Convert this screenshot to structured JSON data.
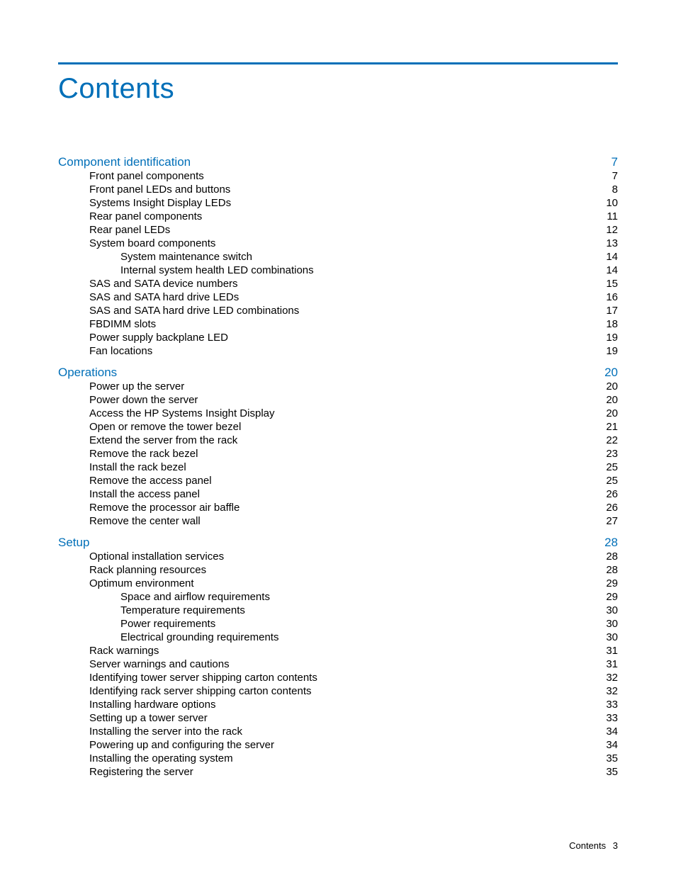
{
  "title": "Contents",
  "footer": {
    "label": "Contents",
    "page": "3"
  },
  "sections": [
    {
      "heading": {
        "label": "Component identification",
        "page": "7"
      },
      "entries": [
        {
          "level": 1,
          "label": "Front panel components",
          "page": "7"
        },
        {
          "level": 1,
          "label": "Front panel LEDs and buttons",
          "page": "8"
        },
        {
          "level": 1,
          "label": "Systems Insight Display LEDs",
          "page": "10"
        },
        {
          "level": 1,
          "label": "Rear panel components",
          "page": "11"
        },
        {
          "level": 1,
          "label": "Rear panel LEDs",
          "page": "12"
        },
        {
          "level": 1,
          "label": "System board components",
          "page": "13"
        },
        {
          "level": 2,
          "label": "System maintenance switch",
          "page": "14"
        },
        {
          "level": 2,
          "label": "Internal system health LED combinations",
          "page": "14"
        },
        {
          "level": 1,
          "label": "SAS and SATA device numbers",
          "page": "15"
        },
        {
          "level": 1,
          "label": "SAS and SATA hard drive LEDs",
          "page": "16"
        },
        {
          "level": 1,
          "label": "SAS and SATA hard drive LED combinations",
          "page": "17"
        },
        {
          "level": 1,
          "label": "FBDIMM slots",
          "page": "18"
        },
        {
          "level": 1,
          "label": "Power supply backplane LED",
          "page": "19"
        },
        {
          "level": 1,
          "label": "Fan locations",
          "page": "19"
        }
      ]
    },
    {
      "heading": {
        "label": "Operations",
        "page": "20"
      },
      "entries": [
        {
          "level": 1,
          "label": "Power up the server",
          "page": "20"
        },
        {
          "level": 1,
          "label": "Power down the server",
          "page": "20"
        },
        {
          "level": 1,
          "label": "Access the HP Systems Insight Display",
          "page": "20"
        },
        {
          "level": 1,
          "label": "Open or remove the tower bezel",
          "page": "21"
        },
        {
          "level": 1,
          "label": "Extend the server from the rack",
          "page": "22"
        },
        {
          "level": 1,
          "label": "Remove the rack bezel",
          "page": "23"
        },
        {
          "level": 1,
          "label": "Install the rack bezel",
          "page": "25"
        },
        {
          "level": 1,
          "label": "Remove the access panel",
          "page": "25"
        },
        {
          "level": 1,
          "label": "Install the access panel",
          "page": "26"
        },
        {
          "level": 1,
          "label": "Remove the processor air baffle",
          "page": "26"
        },
        {
          "level": 1,
          "label": "Remove the center wall",
          "page": "27"
        }
      ]
    },
    {
      "heading": {
        "label": "Setup",
        "page": "28"
      },
      "entries": [
        {
          "level": 1,
          "label": "Optional installation services",
          "page": "28"
        },
        {
          "level": 1,
          "label": "Rack planning resources",
          "page": "28"
        },
        {
          "level": 1,
          "label": "Optimum environment",
          "page": "29"
        },
        {
          "level": 2,
          "label": "Space and airflow requirements",
          "page": "29"
        },
        {
          "level": 2,
          "label": "Temperature requirements",
          "page": "30"
        },
        {
          "level": 2,
          "label": "Power requirements",
          "page": "30"
        },
        {
          "level": 2,
          "label": "Electrical grounding requirements",
          "page": "30"
        },
        {
          "level": 1,
          "label": "Rack warnings",
          "page": "31"
        },
        {
          "level": 1,
          "label": "Server warnings and cautions",
          "page": "31"
        },
        {
          "level": 1,
          "label": "Identifying tower server shipping carton contents",
          "page": "32"
        },
        {
          "level": 1,
          "label": "Identifying rack server shipping carton contents",
          "page": "32"
        },
        {
          "level": 1,
          "label": "Installing hardware options",
          "page": "33"
        },
        {
          "level": 1,
          "label": "Setting up a tower server",
          "page": "33"
        },
        {
          "level": 1,
          "label": "Installing the server into the rack",
          "page": "34"
        },
        {
          "level": 1,
          "label": "Powering up and configuring the server",
          "page": "34"
        },
        {
          "level": 1,
          "label": "Installing the operating system",
          "page": "35"
        },
        {
          "level": 1,
          "label": "Registering the server",
          "page": "35"
        }
      ]
    }
  ]
}
